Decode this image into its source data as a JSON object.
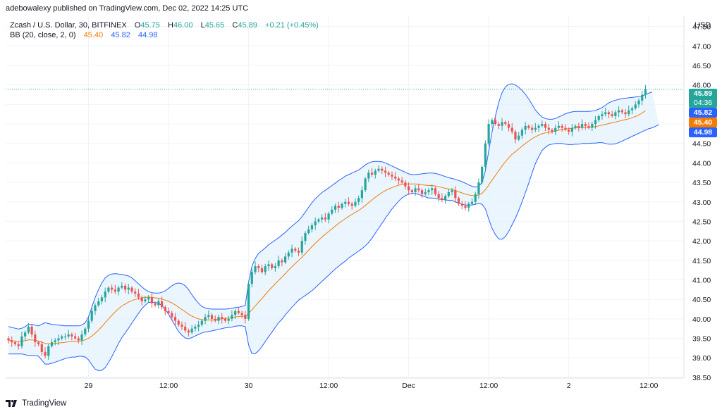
{
  "header": {
    "publisher": "adebowalexy published on TradingView.com, Dec 02, 2022 14:25 UTC"
  },
  "legend": {
    "symbol": "Zcash / U.S. Dollar, 30, BITFINEX",
    "open_label": "O",
    "open": "45.75",
    "high_label": "H",
    "high": "46.00",
    "low_label": "L",
    "low": "45.65",
    "close_label": "C",
    "close": "45.89",
    "change": "+0.21 (+0.45%)",
    "indicator": "BB (20, close, 2, 0)",
    "basis": "45.40",
    "upper": "45.82",
    "lower": "44.98"
  },
  "axis": {
    "currency": "USD"
  },
  "price_tags": {
    "last": "45.89",
    "countdown": "04:36",
    "upper": "45.82",
    "basis": "45.40",
    "lower": "44.98"
  },
  "footer": {
    "brand": "TradingView"
  },
  "colors": {
    "up": "#26a69a",
    "down": "#ef5350",
    "basis": "#f57c00",
    "band": "#2962ff",
    "band_fill": "#e3f2fd",
    "grid": "#f0f3fa"
  },
  "chart_data": {
    "type": "candlestick",
    "interval": "30",
    "y_ticks": [
      "47.50",
      "47.00",
      "46.50",
      "46.00",
      "45.50",
      "45.00",
      "44.50",
      "44.00",
      "43.50",
      "43.00",
      "42.50",
      "42.00",
      "41.50",
      "41.00",
      "40.50",
      "40.00",
      "39.50",
      "39.00",
      "38.50"
    ],
    "ylim": [
      38.3,
      47.8
    ],
    "x_ticks": [
      {
        "label": "29",
        "index": 24
      },
      {
        "label": "12:00",
        "index": 48
      },
      {
        "label": "30",
        "index": 72
      },
      {
        "label": "12:00",
        "index": 96
      },
      {
        "label": "Dec",
        "index": 120
      },
      {
        "label": "12:00",
        "index": 144
      },
      {
        "label": "2",
        "index": 168
      },
      {
        "label": "12:00",
        "index": 192
      }
    ],
    "close": [
      39.45,
      39.4,
      39.35,
      39.3,
      39.55,
      39.65,
      39.8,
      39.6,
      39.4,
      39.35,
      39.15,
      39.05,
      39.3,
      39.4,
      39.45,
      39.5,
      39.55,
      39.55,
      39.6,
      39.55,
      39.5,
      39.45,
      39.6,
      39.75,
      39.95,
      40.2,
      40.35,
      40.45,
      40.55,
      40.7,
      40.8,
      40.75,
      40.7,
      40.8,
      40.85,
      40.75,
      40.8,
      40.7,
      40.65,
      40.55,
      40.45,
      40.5,
      40.55,
      40.4,
      40.35,
      40.45,
      40.3,
      40.2,
      40.15,
      40.05,
      39.95,
      39.85,
      39.8,
      39.7,
      39.65,
      39.75,
      39.8,
      39.85,
      39.95,
      40.05,
      40.1,
      40.0,
      39.95,
      40.05,
      40.0,
      39.95,
      40.0,
      40.1,
      40.2,
      40.15,
      40.1,
      40.0,
      40.9,
      41.2,
      41.35,
      41.3,
      41.2,
      41.35,
      41.4,
      41.3,
      41.35,
      41.5,
      41.45,
      41.6,
      41.7,
      41.8,
      41.75,
      41.7,
      42.0,
      42.2,
      42.3,
      42.4,
      42.5,
      42.55,
      42.6,
      42.55,
      42.7,
      42.8,
      42.9,
      42.85,
      42.95,
      43.0,
      42.95,
      42.9,
      43.0,
      43.1,
      43.3,
      43.6,
      43.75,
      43.7,
      43.8,
      43.85,
      43.8,
      43.75,
      43.7,
      43.65,
      43.6,
      43.55,
      43.5,
      43.4,
      43.3,
      43.25,
      43.35,
      43.3,
      43.2,
      43.25,
      43.3,
      43.35,
      43.2,
      43.1,
      43.05,
      43.15,
      43.25,
      43.3,
      43.1,
      42.95,
      42.9,
      42.85,
      42.95,
      43.0,
      43.2,
      43.5,
      43.9,
      44.5,
      45.0,
      45.1,
      45.0,
      44.95,
      45.05,
      45.0,
      44.9,
      44.8,
      44.6,
      44.7,
      44.85,
      44.95,
      44.9,
      44.85,
      44.9,
      44.95,
      45.0,
      44.9,
      44.85,
      44.8,
      44.9,
      44.95,
      44.9,
      44.85,
      44.8,
      44.9,
      44.95,
      44.9,
      45.0,
      44.95,
      44.9,
      45.0,
      45.1,
      45.2,
      45.25,
      45.3,
      45.25,
      45.2,
      45.3,
      45.35,
      45.3,
      45.25,
      45.35,
      45.4,
      45.5,
      45.6,
      45.75,
      45.89
    ],
    "basis": [
      39.45,
      39.44,
      39.43,
      39.42,
      39.43,
      39.44,
      39.46,
      39.46,
      39.45,
      39.43,
      39.4,
      39.37,
      39.36,
      39.36,
      39.37,
      39.38,
      39.39,
      39.4,
      39.41,
      39.42,
      39.42,
      39.43,
      39.44,
      39.46,
      39.5,
      39.56,
      39.63,
      39.71,
      39.8,
      39.9,
      40.0,
      40.09,
      40.18,
      40.26,
      40.33,
      40.38,
      40.43,
      40.47,
      40.5,
      40.52,
      40.54,
      40.55,
      40.56,
      40.55,
      40.54,
      40.53,
      40.51,
      40.48,
      40.45,
      40.41,
      40.36,
      40.3,
      40.24,
      40.18,
      40.12,
      40.07,
      40.03,
      40.0,
      39.98,
      39.97,
      39.97,
      39.97,
      39.98,
      39.99,
      40.0,
      40.01,
      40.02,
      40.03,
      40.05,
      40.06,
      40.07,
      40.07,
      40.14,
      40.23,
      40.33,
      40.43,
      40.52,
      40.62,
      40.72,
      40.81,
      40.9,
      40.99,
      41.07,
      41.16,
      41.25,
      41.34,
      41.42,
      41.5,
      41.58,
      41.67,
      41.76,
      41.85,
      41.94,
      42.02,
      42.1,
      42.17,
      42.24,
      42.31,
      42.38,
      42.45,
      42.51,
      42.57,
      42.63,
      42.68,
      42.73,
      42.78,
      42.84,
      42.91,
      42.98,
      43.05,
      43.12,
      43.18,
      43.24,
      43.29,
      43.33,
      43.37,
      43.4,
      43.43,
      43.45,
      43.46,
      43.46,
      43.46,
      43.46,
      43.45,
      43.44,
      43.43,
      43.42,
      43.42,
      43.41,
      43.39,
      43.37,
      43.35,
      43.33,
      43.32,
      43.29,
      43.26,
      43.23,
      43.2,
      43.18,
      43.16,
      43.16,
      43.18,
      43.22,
      43.31,
      43.43,
      43.56,
      43.68,
      43.8,
      43.92,
      44.03,
      44.13,
      44.22,
      44.29,
      44.36,
      44.43,
      44.5,
      44.56,
      44.62,
      44.67,
      44.71,
      44.75,
      44.77,
      44.79,
      44.8,
      44.82,
      44.84,
      44.86,
      44.87,
      44.88,
      44.89,
      44.9,
      44.9,
      44.91,
      44.91,
      44.91,
      44.92,
      44.93,
      44.95,
      44.97,
      44.99,
      45.01,
      45.03,
      45.05,
      45.07,
      45.09,
      45.11,
      45.13,
      45.16,
      45.19,
      45.23,
      45.28,
      45.34
    ],
    "upper": [
      39.8,
      39.78,
      39.76,
      39.74,
      39.76,
      39.8,
      39.86,
      39.86,
      39.84,
      39.82,
      39.86,
      39.9,
      39.88,
      39.86,
      39.85,
      39.84,
      39.83,
      39.82,
      39.82,
      39.82,
      39.82,
      39.82,
      39.84,
      39.9,
      40.05,
      40.3,
      40.55,
      40.75,
      40.92,
      41.05,
      41.12,
      41.15,
      41.16,
      41.15,
      41.14,
      41.12,
      41.1,
      41.05,
      40.98,
      40.9,
      40.82,
      40.75,
      40.7,
      40.67,
      40.66,
      40.66,
      40.68,
      40.72,
      40.78,
      40.85,
      40.9,
      40.92,
      40.9,
      40.85,
      40.75,
      40.62,
      40.5,
      40.4,
      40.32,
      40.28,
      40.26,
      40.25,
      40.25,
      40.25,
      40.25,
      40.25,
      40.26,
      40.27,
      40.29,
      40.3,
      40.32,
      40.34,
      40.95,
      41.35,
      41.55,
      41.68,
      41.75,
      41.82,
      41.9,
      41.96,
      42.02,
      42.08,
      42.15,
      42.22,
      42.3,
      42.38,
      42.45,
      42.52,
      42.62,
      42.74,
      42.86,
      42.98,
      43.08,
      43.16,
      43.24,
      43.3,
      43.36,
      43.42,
      43.48,
      43.55,
      43.6,
      43.66,
      43.7,
      43.74,
      43.78,
      43.82,
      43.88,
      43.95,
      44.0,
      44.03,
      44.04,
      44.04,
      44.03,
      44.0,
      43.96,
      43.92,
      43.88,
      43.84,
      43.8,
      43.76,
      43.72,
      43.7,
      43.7,
      43.71,
      43.72,
      43.73,
      43.74,
      43.74,
      43.73,
      43.71,
      43.68,
      43.65,
      43.62,
      43.6,
      43.58,
      43.55,
      43.52,
      43.48,
      43.44,
      43.4,
      43.38,
      43.4,
      43.5,
      43.8,
      44.3,
      44.8,
      45.2,
      45.55,
      45.8,
      45.95,
      46.02,
      46.03,
      46.0,
      45.94,
      45.86,
      45.76,
      45.64,
      45.5,
      45.36,
      45.26,
      45.18,
      45.14,
      45.12,
      45.12,
      45.14,
      45.18,
      45.22,
      45.26,
      45.29,
      45.31,
      45.32,
      45.32,
      45.32,
      45.32,
      45.32,
      45.33,
      45.35,
      45.38,
      45.42,
      45.48,
      45.54,
      45.58,
      45.61,
      45.63,
      45.65,
      45.66,
      45.67,
      45.68,
      45.69,
      45.7,
      45.72,
      45.75,
      45.79,
      45.82
    ],
    "lower": [
      39.1,
      39.1,
      39.1,
      39.1,
      39.1,
      39.08,
      39.06,
      39.06,
      39.06,
      39.04,
      38.94,
      38.84,
      38.84,
      38.86,
      38.89,
      38.92,
      38.95,
      38.98,
      39.0,
      39.02,
      39.02,
      39.04,
      39.04,
      39.02,
      38.95,
      38.82,
      38.71,
      38.67,
      38.68,
      38.75,
      38.88,
      39.03,
      39.2,
      39.37,
      39.52,
      39.64,
      39.76,
      39.89,
      40.02,
      40.14,
      40.26,
      40.35,
      40.42,
      40.43,
      40.42,
      40.4,
      40.34,
      40.24,
      40.12,
      39.97,
      39.82,
      39.68,
      39.58,
      39.51,
      39.49,
      39.52,
      39.56,
      39.6,
      39.64,
      39.66,
      39.68,
      39.69,
      39.71,
      39.73,
      39.75,
      39.77,
      39.78,
      39.79,
      39.81,
      39.82,
      39.82,
      39.8,
      39.33,
      39.11,
      39.11,
      39.18,
      39.29,
      39.42,
      39.54,
      39.66,
      39.78,
      39.9,
      39.99,
      40.1,
      40.2,
      40.3,
      40.39,
      40.48,
      40.54,
      40.6,
      40.66,
      40.72,
      40.8,
      40.88,
      40.96,
      41.04,
      41.12,
      41.2,
      41.28,
      41.35,
      41.42,
      41.48,
      41.56,
      41.62,
      41.68,
      41.74,
      41.8,
      41.87,
      41.96,
      42.07,
      42.2,
      42.32,
      42.45,
      42.58,
      42.7,
      42.82,
      42.92,
      43.02,
      43.1,
      43.16,
      43.2,
      43.22,
      43.22,
      43.19,
      43.16,
      43.13,
      43.1,
      43.1,
      43.09,
      43.07,
      43.06,
      43.05,
      43.04,
      43.04,
      43.0,
      42.97,
      42.94,
      42.92,
      42.92,
      42.92,
      42.94,
      42.96,
      42.94,
      42.82,
      42.56,
      42.32,
      42.16,
      42.05,
      42.04,
      42.11,
      42.24,
      42.41,
      42.58,
      42.78,
      43.0,
      43.24,
      43.48,
      43.74,
      43.98,
      44.16,
      44.32,
      44.4,
      44.46,
      44.48,
      44.5,
      44.5,
      44.5,
      44.48,
      44.47,
      44.47,
      44.48,
      44.48,
      44.5,
      44.5,
      44.5,
      44.51,
      44.51,
      44.52,
      44.52,
      44.5,
      44.48,
      44.48,
      44.49,
      44.52,
      44.56,
      44.6,
      44.64,
      44.68,
      44.72,
      44.76,
      44.8,
      44.84,
      44.88,
      44.9,
      44.94,
      44.98
    ]
  }
}
